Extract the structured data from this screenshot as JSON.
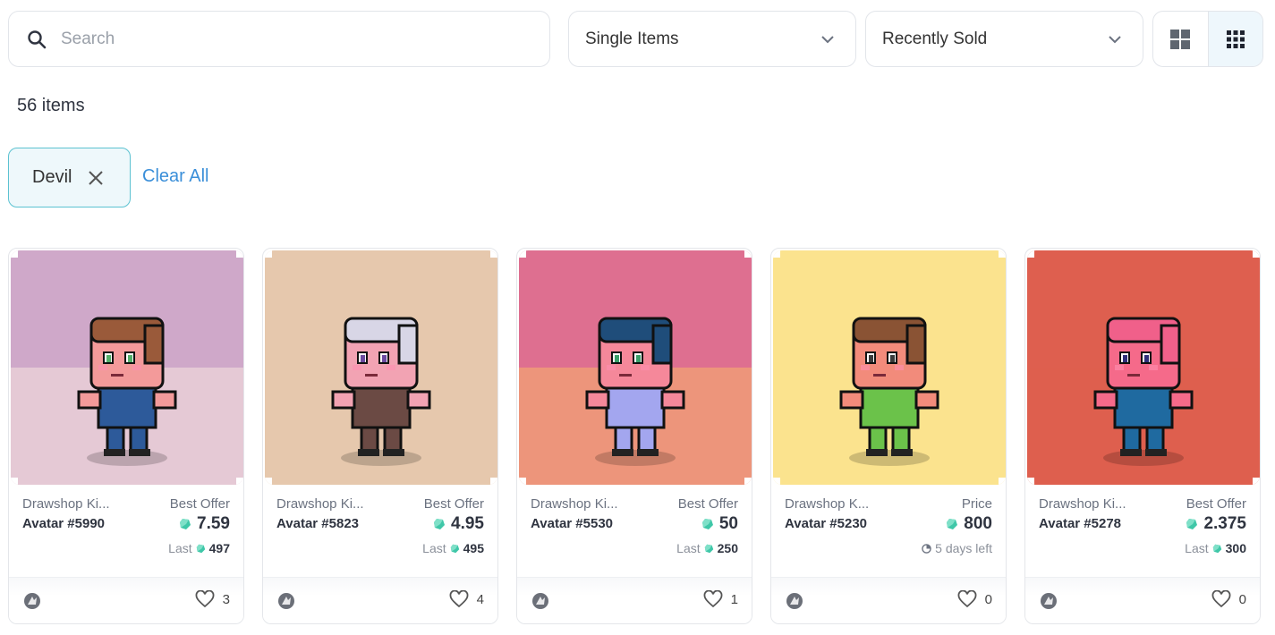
{
  "search": {
    "placeholder": "Search",
    "icon": "search-icon"
  },
  "filters": {
    "type_select": {
      "value": "Single Items",
      "icon": "chevron-down-icon"
    },
    "sort_select": {
      "value": "Recently Sold",
      "icon": "chevron-down-icon"
    },
    "view": {
      "options": [
        "large-grid-icon",
        "small-grid-icon"
      ],
      "active": "small-grid-icon"
    }
  },
  "results": {
    "count_label": "56 items"
  },
  "active_filters": {
    "chips": [
      {
        "label": "Devil"
      }
    ],
    "clear_all_label": "Clear All"
  },
  "colors": {
    "accent": "#5cc2d1",
    "link": "#3b8fd9",
    "gem": "#3fc7a8"
  },
  "cards": [
    {
      "collection": "Drawshop Ki...",
      "name": "Avatar #5990",
      "price_label": "Best Offer",
      "price": "7.59",
      "last_label": "Last",
      "last": "497",
      "likes": "3",
      "art": {
        "bg_top": "#cfa8c9",
        "bg_bottom": "#f7e4de",
        "skin": "#f39a9a",
        "hair": "#9a5a3a",
        "outfit": "#2d5a9a",
        "eyes": "#55b06a"
      }
    },
    {
      "collection": "Drawshop Ki...",
      "name": "Avatar #5823",
      "price_label": "Best Offer",
      "price": "4.95",
      "last_label": "Last",
      "last": "495",
      "likes": "4",
      "art": {
        "bg_top": "#e6c8ad",
        "bg_bottom": "#e6c8ad",
        "skin": "#f2a3b3",
        "hair": "#d8d6e6",
        "outfit": "#6b4a44",
        "eyes": "#6b4aa0"
      }
    },
    {
      "collection": "Drawshop Ki...",
      "name": "Avatar #5530",
      "price_label": "Best Offer",
      "price": "50",
      "last_label": "Last",
      "last": "250",
      "likes": "1",
      "art": {
        "bg_top": "#de6f90",
        "bg_bottom": "#f9b56a",
        "skin": "#f5889a",
        "hair": "#1f4d7a",
        "outfit": "#a3a6ef",
        "eyes": "#3aa06a"
      }
    },
    {
      "collection": "Drawshop K...",
      "name": "Avatar #5230",
      "price_label": "Price",
      "price": "800",
      "time_left": "5 days left",
      "likes": "0",
      "art": {
        "bg_top": "#fbe38e",
        "bg_bottom": "#fbe38e",
        "skin": "#f28b7b",
        "hair": "#8a5334",
        "outfit": "#6bc24a",
        "eyes": "#3a3a3a"
      }
    },
    {
      "collection": "Drawshop Ki...",
      "name": "Avatar #5278",
      "price_label": "Best Offer",
      "price": "2.375",
      "last_label": "Last",
      "last": "300",
      "likes": "0",
      "art": {
        "bg_top": "#de5f4f",
        "bg_bottom": "#de5f4f",
        "skin": "#f56a8a",
        "hair": "#f0608a",
        "outfit": "#1f6aa0",
        "eyes": "#2f2f7a"
      }
    }
  ]
}
